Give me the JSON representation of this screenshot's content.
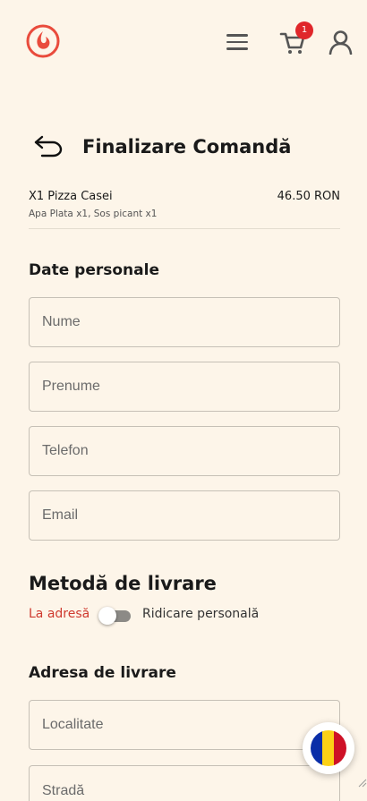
{
  "header": {
    "cart_count": "1"
  },
  "page": {
    "title": "Finalizare Comandă"
  },
  "order": {
    "item_name": "X1 Pizza Casei",
    "item_price": "46.50 RON",
    "item_extras": "Apa Plata x1, Sos picant x1"
  },
  "personal": {
    "title": "Date personale",
    "fields": {
      "nume": "Nume",
      "prenume": "Prenume",
      "telefon": "Telefon",
      "email": "Email"
    }
  },
  "delivery_method": {
    "title": "Metodă de livrare",
    "option_left": "La adresă",
    "option_right": "Ridicare personală",
    "selected": "La adresă"
  },
  "delivery_address": {
    "title": "Adresa de livrare",
    "fields": {
      "localitate": "Localitate",
      "strada": "Stradă"
    }
  },
  "language": {
    "flag": "romania-flag-icon"
  },
  "colors": {
    "background": "#fdf5e9",
    "brand_red": "#e94b3c",
    "badge_red": "#e0262a",
    "active_option": "#cf3a2f"
  }
}
